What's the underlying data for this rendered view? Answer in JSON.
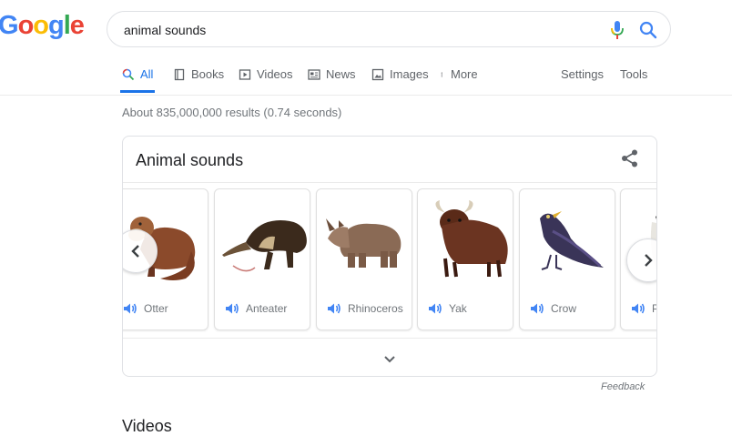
{
  "logo": {
    "letters": [
      "G",
      "o",
      "o",
      "g",
      "l",
      "e"
    ],
    "colors": [
      "#4285F4",
      "#EA4335",
      "#FBBC05",
      "#4285F4",
      "#34A853",
      "#EA4335"
    ]
  },
  "search": {
    "query": "animal sounds",
    "icons": [
      "mic-icon",
      "search-icon"
    ]
  },
  "tabs": [
    {
      "label": "All",
      "icon": "search-icon",
      "active": true
    },
    {
      "label": "Books",
      "icon": "book-icon"
    },
    {
      "label": "Videos",
      "icon": "play-icon"
    },
    {
      "label": "News",
      "icon": "news-icon"
    },
    {
      "label": "Images",
      "icon": "image-icon"
    },
    {
      "label": "More",
      "icon": "more-vert-icon"
    }
  ],
  "tools": {
    "settings": "Settings",
    "tools": "Tools"
  },
  "result_stats": "About 835,000,000 results (0.74 seconds)",
  "card": {
    "title": "Animal sounds",
    "animals": [
      {
        "name": "Otter"
      },
      {
        "name": "Anteater"
      },
      {
        "name": "Rhinoceros"
      },
      {
        "name": "Yak"
      },
      {
        "name": "Crow"
      },
      {
        "name": "P"
      }
    ]
  },
  "feedback": "Feedback",
  "videos_heading": "Videos",
  "colors": {
    "accent": "#1a73e8",
    "speaker": "#4285F4",
    "text_secondary": "#70757a"
  }
}
